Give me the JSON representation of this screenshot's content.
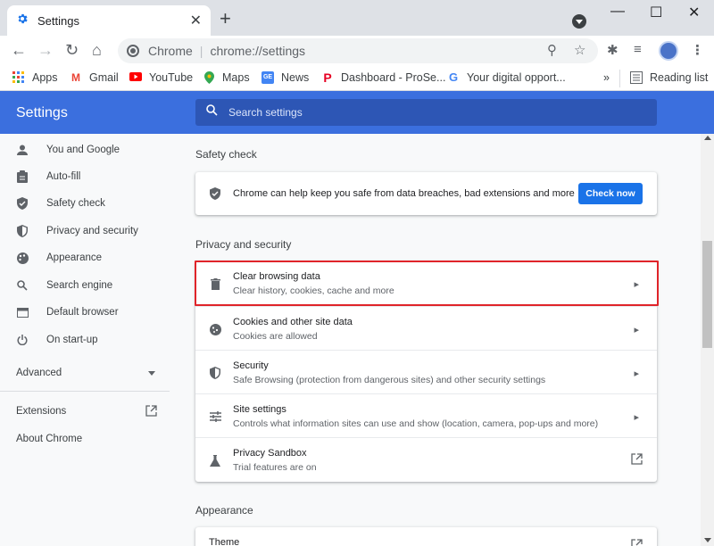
{
  "tab": {
    "title": "Settings"
  },
  "window": {
    "minimize": "—",
    "maximize": "☐",
    "close": "✕"
  },
  "toolbar": {
    "chip": "Chrome",
    "url": "chrome://settings"
  },
  "bookmarks": [
    {
      "label": "Apps",
      "icon": "apps-grid-icon"
    },
    {
      "label": "Gmail",
      "icon": "gmail-icon"
    },
    {
      "label": "YouTube",
      "icon": "youtube-icon"
    },
    {
      "label": "Maps",
      "icon": "maps-icon"
    },
    {
      "label": "News",
      "icon": "news-icon"
    },
    {
      "label": "Dashboard - ProSe...",
      "icon": "pinterest-icon"
    },
    {
      "label": "Your digital opport...",
      "icon": "google-icon"
    }
  ],
  "reading_list": "Reading list",
  "more_bookmarks": "»",
  "header": {
    "title": "Settings",
    "search_placeholder": "Search settings"
  },
  "sidebar": {
    "items": [
      {
        "label": "You and Google",
        "icon": "person-icon"
      },
      {
        "label": "Auto-fill",
        "icon": "clipboard-icon"
      },
      {
        "label": "Safety check",
        "icon": "shield-check-icon"
      },
      {
        "label": "Privacy and security",
        "icon": "shield-icon"
      },
      {
        "label": "Appearance",
        "icon": "palette-icon"
      },
      {
        "label": "Search engine",
        "icon": "search-icon"
      },
      {
        "label": "Default browser",
        "icon": "browser-icon"
      },
      {
        "label": "On start-up",
        "icon": "power-icon"
      }
    ],
    "advanced": "Advanced",
    "extensions": "Extensions",
    "about": "About Chrome"
  },
  "safety": {
    "section_title": "Safety check",
    "text": "Chrome can help keep you safe from data breaches, bad extensions and more",
    "button": "Check now"
  },
  "privacy": {
    "section_title": "Privacy and security",
    "rows": [
      {
        "title": "Clear browsing data",
        "sub": "Clear history, cookies, cache and more",
        "icon": "trash-icon"
      },
      {
        "title": "Cookies and other site data",
        "sub": "Cookies are allowed",
        "icon": "cookie-icon"
      },
      {
        "title": "Security",
        "sub": "Safe Browsing (protection from dangerous sites) and other security settings",
        "icon": "shield-icon"
      },
      {
        "title": "Site settings",
        "sub": "Controls what information sites can use and show (location, camera, pop-ups and more)",
        "icon": "tune-icon"
      },
      {
        "title": "Privacy Sandbox",
        "sub": "Trial features are on",
        "icon": "flask-icon"
      }
    ]
  },
  "appearance": {
    "section_title": "Appearance",
    "first_row": "Theme"
  },
  "colors": {
    "header": "#3b6fde",
    "highlight": "#e0242a",
    "button": "#1a73e8"
  }
}
